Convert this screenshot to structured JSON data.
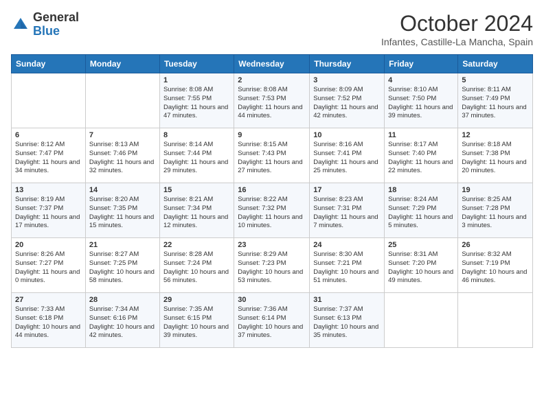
{
  "logo": {
    "general": "General",
    "blue": "Blue"
  },
  "header": {
    "month": "October 2024",
    "location": "Infantes, Castille-La Mancha, Spain"
  },
  "days_of_week": [
    "Sunday",
    "Monday",
    "Tuesday",
    "Wednesday",
    "Thursday",
    "Friday",
    "Saturday"
  ],
  "weeks": [
    [
      {
        "day": "",
        "sunrise": "",
        "sunset": "",
        "daylight": ""
      },
      {
        "day": "",
        "sunrise": "",
        "sunset": "",
        "daylight": ""
      },
      {
        "day": "1",
        "sunrise": "Sunrise: 8:08 AM",
        "sunset": "Sunset: 7:55 PM",
        "daylight": "Daylight: 11 hours and 47 minutes."
      },
      {
        "day": "2",
        "sunrise": "Sunrise: 8:08 AM",
        "sunset": "Sunset: 7:53 PM",
        "daylight": "Daylight: 11 hours and 44 minutes."
      },
      {
        "day": "3",
        "sunrise": "Sunrise: 8:09 AM",
        "sunset": "Sunset: 7:52 PM",
        "daylight": "Daylight: 11 hours and 42 minutes."
      },
      {
        "day": "4",
        "sunrise": "Sunrise: 8:10 AM",
        "sunset": "Sunset: 7:50 PM",
        "daylight": "Daylight: 11 hours and 39 minutes."
      },
      {
        "day": "5",
        "sunrise": "Sunrise: 8:11 AM",
        "sunset": "Sunset: 7:49 PM",
        "daylight": "Daylight: 11 hours and 37 minutes."
      }
    ],
    [
      {
        "day": "6",
        "sunrise": "Sunrise: 8:12 AM",
        "sunset": "Sunset: 7:47 PM",
        "daylight": "Daylight: 11 hours and 34 minutes."
      },
      {
        "day": "7",
        "sunrise": "Sunrise: 8:13 AM",
        "sunset": "Sunset: 7:46 PM",
        "daylight": "Daylight: 11 hours and 32 minutes."
      },
      {
        "day": "8",
        "sunrise": "Sunrise: 8:14 AM",
        "sunset": "Sunset: 7:44 PM",
        "daylight": "Daylight: 11 hours and 29 minutes."
      },
      {
        "day": "9",
        "sunrise": "Sunrise: 8:15 AM",
        "sunset": "Sunset: 7:43 PM",
        "daylight": "Daylight: 11 hours and 27 minutes."
      },
      {
        "day": "10",
        "sunrise": "Sunrise: 8:16 AM",
        "sunset": "Sunset: 7:41 PM",
        "daylight": "Daylight: 11 hours and 25 minutes."
      },
      {
        "day": "11",
        "sunrise": "Sunrise: 8:17 AM",
        "sunset": "Sunset: 7:40 PM",
        "daylight": "Daylight: 11 hours and 22 minutes."
      },
      {
        "day": "12",
        "sunrise": "Sunrise: 8:18 AM",
        "sunset": "Sunset: 7:38 PM",
        "daylight": "Daylight: 11 hours and 20 minutes."
      }
    ],
    [
      {
        "day": "13",
        "sunrise": "Sunrise: 8:19 AM",
        "sunset": "Sunset: 7:37 PM",
        "daylight": "Daylight: 11 hours and 17 minutes."
      },
      {
        "day": "14",
        "sunrise": "Sunrise: 8:20 AM",
        "sunset": "Sunset: 7:35 PM",
        "daylight": "Daylight: 11 hours and 15 minutes."
      },
      {
        "day": "15",
        "sunrise": "Sunrise: 8:21 AM",
        "sunset": "Sunset: 7:34 PM",
        "daylight": "Daylight: 11 hours and 12 minutes."
      },
      {
        "day": "16",
        "sunrise": "Sunrise: 8:22 AM",
        "sunset": "Sunset: 7:32 PM",
        "daylight": "Daylight: 11 hours and 10 minutes."
      },
      {
        "day": "17",
        "sunrise": "Sunrise: 8:23 AM",
        "sunset": "Sunset: 7:31 PM",
        "daylight": "Daylight: 11 hours and 7 minutes."
      },
      {
        "day": "18",
        "sunrise": "Sunrise: 8:24 AM",
        "sunset": "Sunset: 7:29 PM",
        "daylight": "Daylight: 11 hours and 5 minutes."
      },
      {
        "day": "19",
        "sunrise": "Sunrise: 8:25 AM",
        "sunset": "Sunset: 7:28 PM",
        "daylight": "Daylight: 11 hours and 3 minutes."
      }
    ],
    [
      {
        "day": "20",
        "sunrise": "Sunrise: 8:26 AM",
        "sunset": "Sunset: 7:27 PM",
        "daylight": "Daylight: 11 hours and 0 minutes."
      },
      {
        "day": "21",
        "sunrise": "Sunrise: 8:27 AM",
        "sunset": "Sunset: 7:25 PM",
        "daylight": "Daylight: 10 hours and 58 minutes."
      },
      {
        "day": "22",
        "sunrise": "Sunrise: 8:28 AM",
        "sunset": "Sunset: 7:24 PM",
        "daylight": "Daylight: 10 hours and 56 minutes."
      },
      {
        "day": "23",
        "sunrise": "Sunrise: 8:29 AM",
        "sunset": "Sunset: 7:23 PM",
        "daylight": "Daylight: 10 hours and 53 minutes."
      },
      {
        "day": "24",
        "sunrise": "Sunrise: 8:30 AM",
        "sunset": "Sunset: 7:21 PM",
        "daylight": "Daylight: 10 hours and 51 minutes."
      },
      {
        "day": "25",
        "sunrise": "Sunrise: 8:31 AM",
        "sunset": "Sunset: 7:20 PM",
        "daylight": "Daylight: 10 hours and 49 minutes."
      },
      {
        "day": "26",
        "sunrise": "Sunrise: 8:32 AM",
        "sunset": "Sunset: 7:19 PM",
        "daylight": "Daylight: 10 hours and 46 minutes."
      }
    ],
    [
      {
        "day": "27",
        "sunrise": "Sunrise: 7:33 AM",
        "sunset": "Sunset: 6:18 PM",
        "daylight": "Daylight: 10 hours and 44 minutes."
      },
      {
        "day": "28",
        "sunrise": "Sunrise: 7:34 AM",
        "sunset": "Sunset: 6:16 PM",
        "daylight": "Daylight: 10 hours and 42 minutes."
      },
      {
        "day": "29",
        "sunrise": "Sunrise: 7:35 AM",
        "sunset": "Sunset: 6:15 PM",
        "daylight": "Daylight: 10 hours and 39 minutes."
      },
      {
        "day": "30",
        "sunrise": "Sunrise: 7:36 AM",
        "sunset": "Sunset: 6:14 PM",
        "daylight": "Daylight: 10 hours and 37 minutes."
      },
      {
        "day": "31",
        "sunrise": "Sunrise: 7:37 AM",
        "sunset": "Sunset: 6:13 PM",
        "daylight": "Daylight: 10 hours and 35 minutes."
      },
      {
        "day": "",
        "sunrise": "",
        "sunset": "",
        "daylight": ""
      },
      {
        "day": "",
        "sunrise": "",
        "sunset": "",
        "daylight": ""
      }
    ]
  ]
}
